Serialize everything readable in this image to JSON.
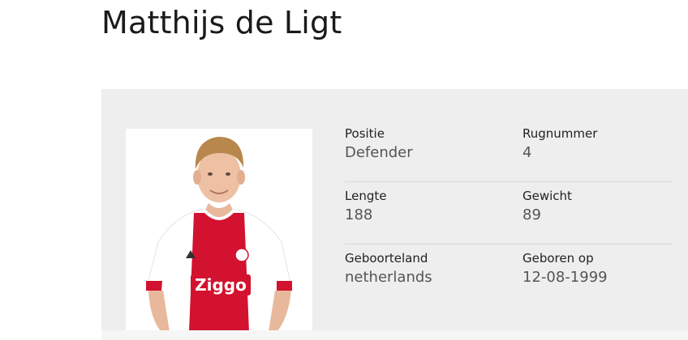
{
  "player": {
    "name": "Matthijs de Ligt"
  },
  "photo": {
    "subject": "player-portrait",
    "sponsor_text": "Ziggo",
    "kit_colors": {
      "primary": "#d2122e",
      "secondary": "#ffffff"
    }
  },
  "stats": [
    [
      {
        "label": "Positie",
        "value": "Defender"
      },
      {
        "label": "Rugnummer",
        "value": "4"
      }
    ],
    [
      {
        "label": "Lengte",
        "value": "188"
      },
      {
        "label": "Gewicht",
        "value": "89"
      }
    ],
    [
      {
        "label": "Geboorteland",
        "value": "netherlands"
      },
      {
        "label": "Geboren op",
        "value": "12-08-1999"
      }
    ]
  ],
  "colors": {
    "panel_background": "#efeeee",
    "divider": "#d9d7d7",
    "label_text": "#222222",
    "value_text": "#555555"
  }
}
